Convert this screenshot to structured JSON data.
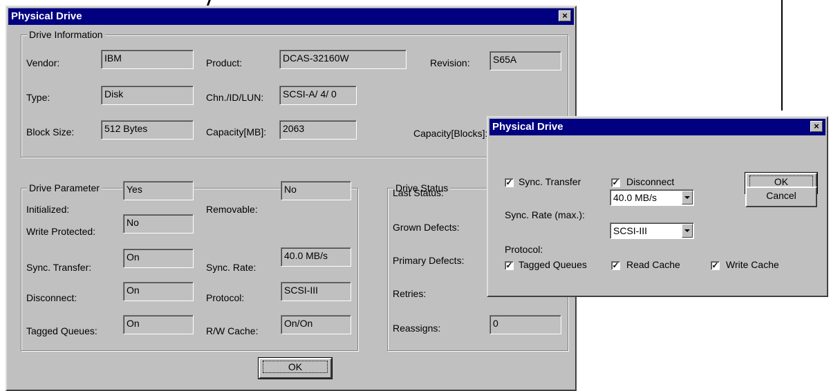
{
  "main_dialog": {
    "title": "Physical Drive",
    "close_glyph": "×",
    "drive_information": {
      "label": "Drive Information",
      "vendor_label": "Vendor:",
      "vendor": "IBM",
      "product_label": "Product:",
      "product": "DCAS-32160W",
      "revision_label": "Revision:",
      "revision": "S65A",
      "type_label": "Type:",
      "type": "Disk",
      "chn_label": "Chn./ID/LUN:",
      "chn": "SCSI-A/ 4/ 0",
      "block_size_label": "Block Size:",
      "block_size": "512 Bytes",
      "capacity_mb_label": "Capacity[MB]:",
      "capacity_mb": "2063",
      "capacity_blocks_label": "Capacity[Blocks]:"
    },
    "drive_parameter": {
      "label": "Drive Parameter",
      "initialized_label": "Initialized:",
      "initialized": "Yes",
      "removable_label": "Removable:",
      "removable": "No",
      "write_protected_label": "Write Protected:",
      "write_protected": "No",
      "sync_transfer_label": "Sync. Transfer:",
      "sync_transfer": "On",
      "sync_rate_label": "Sync. Rate:",
      "sync_rate": "40.0 MB/s",
      "disconnect_label": "Disconnect:",
      "disconnect": "On",
      "protocol_label": "Protocol:",
      "protocol": "SCSI-III",
      "tagged_queues_label": "Tagged Queues:",
      "tagged_queues": "On",
      "rw_cache_label": "R/W Cache:",
      "rw_cache": "On/On"
    },
    "drive_status": {
      "label": "Drive Status",
      "last_status_label": "Last Status:",
      "grown_defects_label": "Grown Defects:",
      "primary_defects_label": "Primary Defects:",
      "retries_label": "Retries:",
      "reassigns_label": "Reassigns:",
      "reassigns": "0"
    },
    "ok_label": "OK"
  },
  "settings_dialog": {
    "title": "Physical Drive",
    "close_glyph": "×",
    "check_glyph": "✓",
    "sync_transfer_label": "Sync. Transfer",
    "sync_transfer_checked": true,
    "disconnect_label": "Disconnect",
    "disconnect_checked": true,
    "sync_rate_label": "Sync. Rate (max.):",
    "sync_rate_value": "40.0 MB/s",
    "protocol_label": "Protocol:",
    "protocol_value": "SCSI-III",
    "tagged_queues_label": "Tagged Queues",
    "tagged_queues_checked": true,
    "read_cache_label": "Read Cache",
    "read_cache_checked": true,
    "write_cache_label": "Write Cache",
    "write_cache_checked": true,
    "ok_label": "OK",
    "cancel_label": "Cancel"
  }
}
